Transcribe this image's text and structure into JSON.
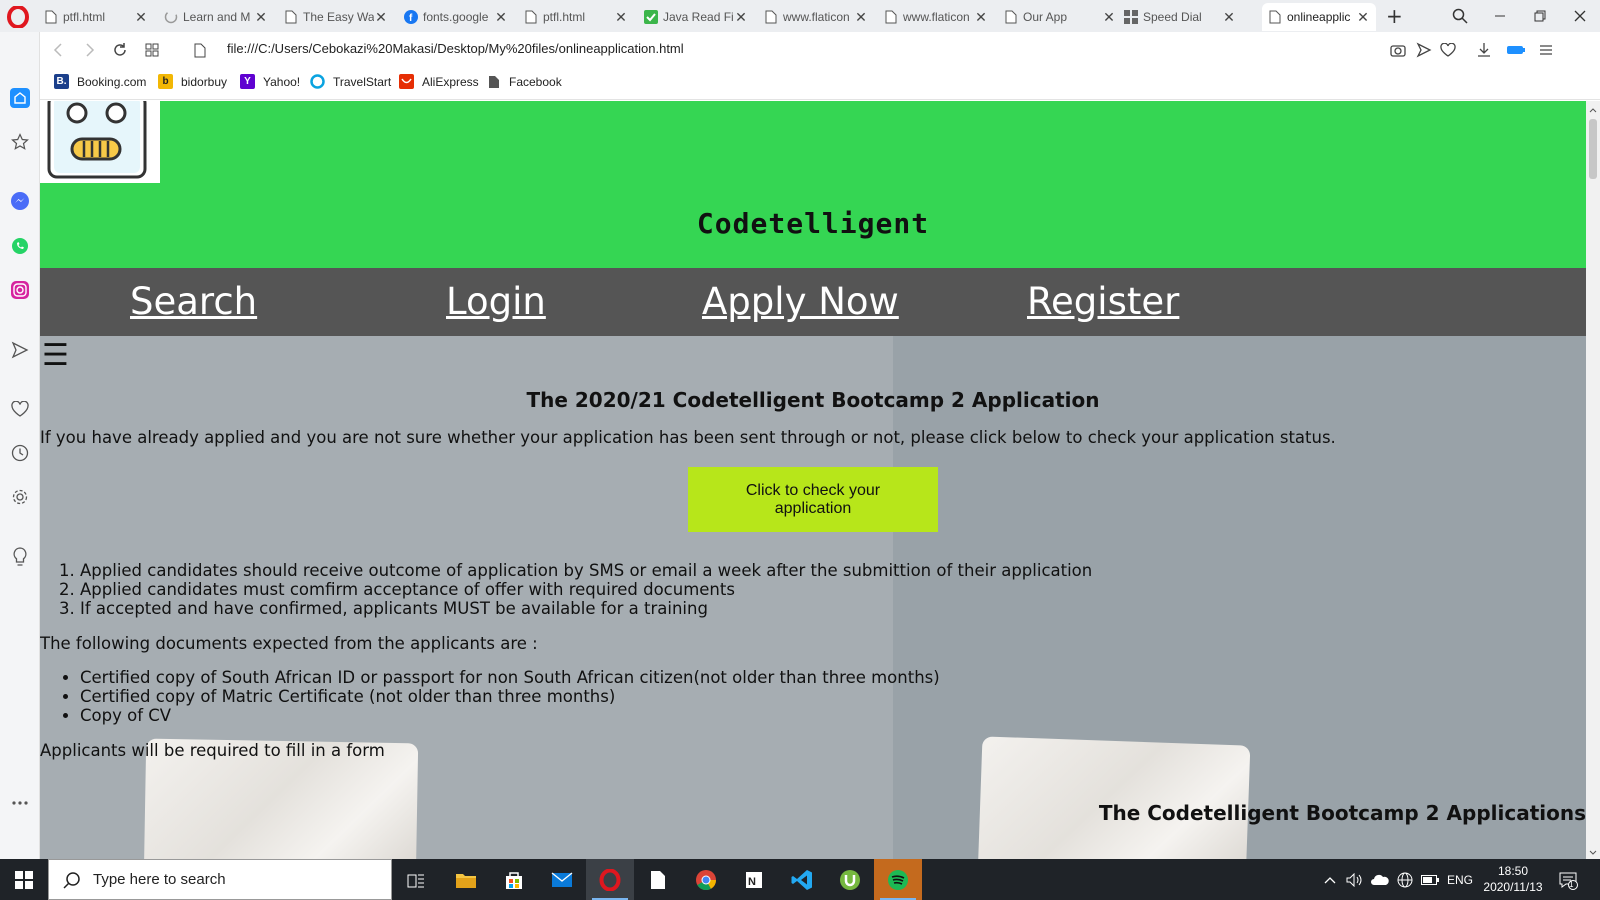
{
  "browser": {
    "tabs": [
      {
        "label": "ptfl.html",
        "icon": "page-icon"
      },
      {
        "label": "Learn and M",
        "icon": "loading-icon"
      },
      {
        "label": "The Easy Wa",
        "icon": "page-icon"
      },
      {
        "label": "fonts.google",
        "icon": "facebook-icon"
      },
      {
        "label": "ptfl.html",
        "icon": "page-icon"
      },
      {
        "label": "Java Read Fi",
        "icon": "codota-icon"
      },
      {
        "label": "www.flaticon",
        "icon": "page-icon"
      },
      {
        "label": "www.flaticon",
        "icon": "page-icon"
      },
      {
        "label": "Our App",
        "icon": "page-icon"
      },
      {
        "label": "Speed Dial",
        "icon": "speed-dial-icon"
      },
      {
        "label": "onlineapplic",
        "icon": "page-icon",
        "active": true
      }
    ],
    "new_tab_label": "+",
    "url": "file:///C:/Users/Cebokazi%20Makasi/Desktop/My%20files/onlineapplication.html",
    "bookmarks": [
      {
        "label": "Booking.com",
        "icon_letter": "B.",
        "color": "#1b3f8b"
      },
      {
        "label": "bidorbuy",
        "icon_letter": "b",
        "color": "#f2b705"
      },
      {
        "label": "Yahoo!",
        "icon_letter": "Y",
        "color": "#5f01d1"
      },
      {
        "label": "TravelStart",
        "icon_letter": "",
        "color": "#0aa3e0"
      },
      {
        "label": "AliExpress",
        "icon_letter": "",
        "color": "#e62e04"
      },
      {
        "label": "Facebook",
        "icon_letter": "",
        "color": "#555555"
      }
    ]
  },
  "page": {
    "site_title": "Codetelligent",
    "nav": [
      "Search",
      "Login",
      "Apply Now",
      "Register"
    ],
    "menu_glyph": "☰",
    "heading": "The 2020/21 Codetelligent Bootcamp 2 Application",
    "intro": "If you have already applied and you are not sure whether your application has been sent through or not, please click below to check your application status.",
    "check_button": "Click to check your application",
    "rules": [
      "Applied candidates should receive outcome of application by SMS or email a week after the submittion of their application",
      "Applied candidates must comfirm acceptance of offer with required documents",
      "If accepted and have confirmed, applicants MUST be available for a training"
    ],
    "docs_intro": "The following documents expected from the applicants are :",
    "docs": [
      "Certified copy of South African ID or passport for non South African citizen(not older than three months)",
      "Certified copy of Matric Certificate (not older than three months)",
      "Copy of CV"
    ],
    "form_note": "Applicants will be required to fill in a form",
    "footer_heading": "The Codetelligent Bootcamp 2 Applications"
  },
  "taskbar": {
    "search_placeholder": "Type here to search",
    "language": "ENG",
    "time": "18:50",
    "date": "2020/11/13",
    "notification_count": "1"
  },
  "colors": {
    "header_green": "#35d653",
    "nav_gray": "#555555",
    "button_lime": "#b7e61a",
    "opera_red": "#e0171f"
  }
}
